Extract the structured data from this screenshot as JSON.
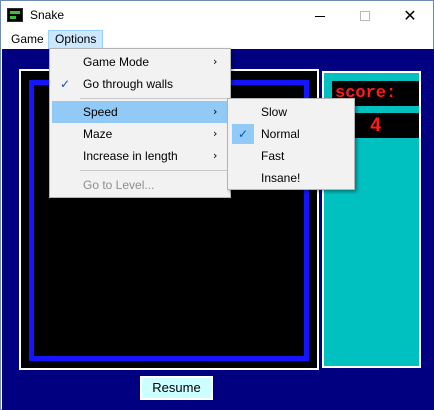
{
  "window": {
    "title": "Snake"
  },
  "icons": {
    "app": "snake-app-icon",
    "minimize": "minimize-icon",
    "maximize": "maximize-icon",
    "close": "close-icon",
    "submenu": "chevron-right-icon",
    "check": "checkmark-icon"
  },
  "menubar": {
    "game": "Game",
    "options": "Options"
  },
  "options_menu": {
    "game_mode": "Game Mode",
    "go_through_walls": "Go through walls",
    "speed": "Speed",
    "maze": "Maze",
    "increase_length": "Increase in length",
    "go_to_level": "Go to Level...",
    "arrow": "›",
    "check": "✓"
  },
  "speed_menu": {
    "slow": "Slow",
    "normal": "Normal",
    "fast": "Fast",
    "insane": "Insane!",
    "selected": "Normal"
  },
  "game": {
    "score_label": "score:",
    "score_value": "4",
    "resume": "Resume"
  },
  "controls": {
    "close_glyph": "✕"
  },
  "colors": {
    "client_bg": "#000080",
    "wall": "#1414ff",
    "panel": "#00c0c0",
    "score_text": "#ff1a1a",
    "resume_bg": "#ccffff",
    "menu_highlight": "#91c9f7"
  }
}
